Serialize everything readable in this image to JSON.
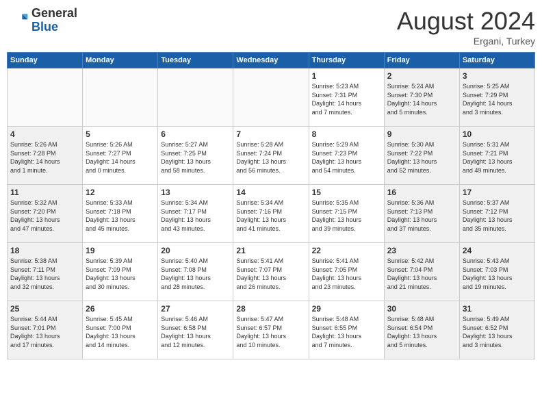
{
  "header": {
    "logo_general": "General",
    "logo_blue": "Blue",
    "month_year": "August 2024",
    "location": "Ergani, Turkey"
  },
  "weekdays": [
    "Sunday",
    "Monday",
    "Tuesday",
    "Wednesday",
    "Thursday",
    "Friday",
    "Saturday"
  ],
  "weeks": [
    [
      {
        "day": "",
        "info": "",
        "type": "empty"
      },
      {
        "day": "",
        "info": "",
        "type": "empty"
      },
      {
        "day": "",
        "info": "",
        "type": "empty"
      },
      {
        "day": "",
        "info": "",
        "type": "empty"
      },
      {
        "day": "1",
        "info": "Sunrise: 5:23 AM\nSunset: 7:31 PM\nDaylight: 14 hours\nand 7 minutes.",
        "type": "weekday"
      },
      {
        "day": "2",
        "info": "Sunrise: 5:24 AM\nSunset: 7:30 PM\nDaylight: 14 hours\nand 5 minutes.",
        "type": "weekend"
      },
      {
        "day": "3",
        "info": "Sunrise: 5:25 AM\nSunset: 7:29 PM\nDaylight: 14 hours\nand 3 minutes.",
        "type": "weekend"
      }
    ],
    [
      {
        "day": "4",
        "info": "Sunrise: 5:26 AM\nSunset: 7:28 PM\nDaylight: 14 hours\nand 1 minute.",
        "type": "weekend"
      },
      {
        "day": "5",
        "info": "Sunrise: 5:26 AM\nSunset: 7:27 PM\nDaylight: 14 hours\nand 0 minutes.",
        "type": "weekday"
      },
      {
        "day": "6",
        "info": "Sunrise: 5:27 AM\nSunset: 7:25 PM\nDaylight: 13 hours\nand 58 minutes.",
        "type": "weekday"
      },
      {
        "day": "7",
        "info": "Sunrise: 5:28 AM\nSunset: 7:24 PM\nDaylight: 13 hours\nand 56 minutes.",
        "type": "weekday"
      },
      {
        "day": "8",
        "info": "Sunrise: 5:29 AM\nSunset: 7:23 PM\nDaylight: 13 hours\nand 54 minutes.",
        "type": "weekday"
      },
      {
        "day": "9",
        "info": "Sunrise: 5:30 AM\nSunset: 7:22 PM\nDaylight: 13 hours\nand 52 minutes.",
        "type": "weekend"
      },
      {
        "day": "10",
        "info": "Sunrise: 5:31 AM\nSunset: 7:21 PM\nDaylight: 13 hours\nand 49 minutes.",
        "type": "weekend"
      }
    ],
    [
      {
        "day": "11",
        "info": "Sunrise: 5:32 AM\nSunset: 7:20 PM\nDaylight: 13 hours\nand 47 minutes.",
        "type": "weekend"
      },
      {
        "day": "12",
        "info": "Sunrise: 5:33 AM\nSunset: 7:18 PM\nDaylight: 13 hours\nand 45 minutes.",
        "type": "weekday"
      },
      {
        "day": "13",
        "info": "Sunrise: 5:34 AM\nSunset: 7:17 PM\nDaylight: 13 hours\nand 43 minutes.",
        "type": "weekday"
      },
      {
        "day": "14",
        "info": "Sunrise: 5:34 AM\nSunset: 7:16 PM\nDaylight: 13 hours\nand 41 minutes.",
        "type": "weekday"
      },
      {
        "day": "15",
        "info": "Sunrise: 5:35 AM\nSunset: 7:15 PM\nDaylight: 13 hours\nand 39 minutes.",
        "type": "weekday"
      },
      {
        "day": "16",
        "info": "Sunrise: 5:36 AM\nSunset: 7:13 PM\nDaylight: 13 hours\nand 37 minutes.",
        "type": "weekend"
      },
      {
        "day": "17",
        "info": "Sunrise: 5:37 AM\nSunset: 7:12 PM\nDaylight: 13 hours\nand 35 minutes.",
        "type": "weekend"
      }
    ],
    [
      {
        "day": "18",
        "info": "Sunrise: 5:38 AM\nSunset: 7:11 PM\nDaylight: 13 hours\nand 32 minutes.",
        "type": "weekend"
      },
      {
        "day": "19",
        "info": "Sunrise: 5:39 AM\nSunset: 7:09 PM\nDaylight: 13 hours\nand 30 minutes.",
        "type": "weekday"
      },
      {
        "day": "20",
        "info": "Sunrise: 5:40 AM\nSunset: 7:08 PM\nDaylight: 13 hours\nand 28 minutes.",
        "type": "weekday"
      },
      {
        "day": "21",
        "info": "Sunrise: 5:41 AM\nSunset: 7:07 PM\nDaylight: 13 hours\nand 26 minutes.",
        "type": "weekday"
      },
      {
        "day": "22",
        "info": "Sunrise: 5:41 AM\nSunset: 7:05 PM\nDaylight: 13 hours\nand 23 minutes.",
        "type": "weekday"
      },
      {
        "day": "23",
        "info": "Sunrise: 5:42 AM\nSunset: 7:04 PM\nDaylight: 13 hours\nand 21 minutes.",
        "type": "weekend"
      },
      {
        "day": "24",
        "info": "Sunrise: 5:43 AM\nSunset: 7:03 PM\nDaylight: 13 hours\nand 19 minutes.",
        "type": "weekend"
      }
    ],
    [
      {
        "day": "25",
        "info": "Sunrise: 5:44 AM\nSunset: 7:01 PM\nDaylight: 13 hours\nand 17 minutes.",
        "type": "weekend"
      },
      {
        "day": "26",
        "info": "Sunrise: 5:45 AM\nSunset: 7:00 PM\nDaylight: 13 hours\nand 14 minutes.",
        "type": "weekday"
      },
      {
        "day": "27",
        "info": "Sunrise: 5:46 AM\nSunset: 6:58 PM\nDaylight: 13 hours\nand 12 minutes.",
        "type": "weekday"
      },
      {
        "day": "28",
        "info": "Sunrise: 5:47 AM\nSunset: 6:57 PM\nDaylight: 13 hours\nand 10 minutes.",
        "type": "weekday"
      },
      {
        "day": "29",
        "info": "Sunrise: 5:48 AM\nSunset: 6:55 PM\nDaylight: 13 hours\nand 7 minutes.",
        "type": "weekday"
      },
      {
        "day": "30",
        "info": "Sunrise: 5:48 AM\nSunset: 6:54 PM\nDaylight: 13 hours\nand 5 minutes.",
        "type": "weekend"
      },
      {
        "day": "31",
        "info": "Sunrise: 5:49 AM\nSunset: 6:52 PM\nDaylight: 13 hours\nand 3 minutes.",
        "type": "weekend"
      }
    ]
  ]
}
